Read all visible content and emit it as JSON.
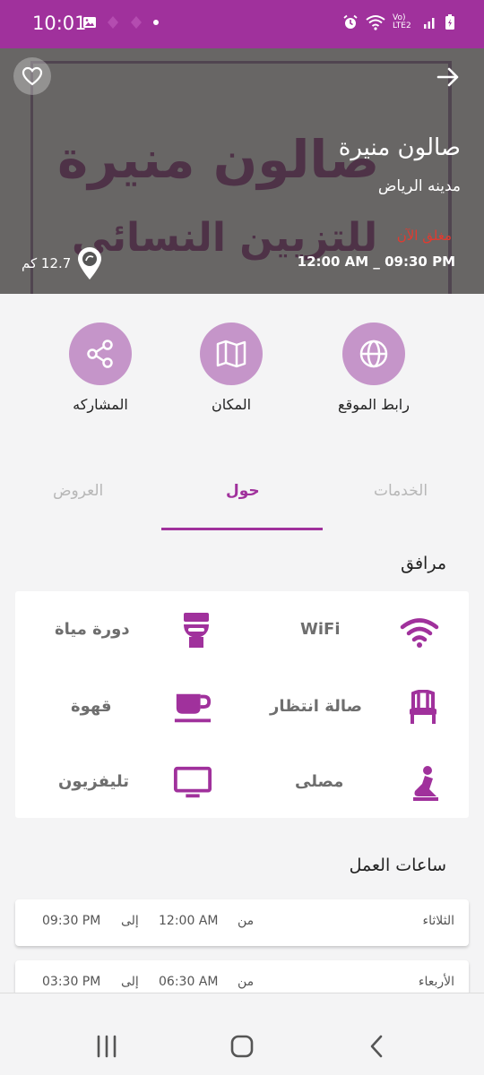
{
  "status_bar": {
    "time": "10:01",
    "network": "Vo) LTE2"
  },
  "hero": {
    "sign_line1": "صالون منيرة",
    "sign_line2": "للتزيين النسائي",
    "name": "صالون منيرة",
    "city": "مدينه الرياض",
    "status": "مغلق الآن",
    "hours": "12:00 AM _ 09:30 PM",
    "distance": "12.7 كم"
  },
  "actions": [
    {
      "label": "رابط الموقع",
      "icon": "globe-icon"
    },
    {
      "label": "المكان",
      "icon": "map-icon"
    },
    {
      "label": "المشاركه",
      "icon": "share-icon"
    }
  ],
  "tabs": {
    "services": "الخدمات",
    "about": "حول",
    "offers": "العروض"
  },
  "facilities_title": "مرافق",
  "facilities": [
    {
      "label": "WiFi",
      "icon": "wifi-icon"
    },
    {
      "label": "دورة مياة",
      "icon": "toilet-icon"
    },
    {
      "label": "صالة انتظار",
      "icon": "chair-icon"
    },
    {
      "label": "قهوة",
      "icon": "coffee-icon"
    },
    {
      "label": "مصلى",
      "icon": "prayer-icon"
    },
    {
      "label": "تليفزيون",
      "icon": "tv-icon"
    }
  ],
  "hours_title": "ساعات العمل",
  "working_hours": [
    {
      "day": "الثلاثاء",
      "from_label": "من",
      "start": "12:00 AM",
      "to_label": "إلى",
      "end": "09:30 PM"
    },
    {
      "day": "الأربعاء",
      "from_label": "من",
      "start": "06:30 AM",
      "to_label": "إلى",
      "end": "03:30 PM"
    }
  ],
  "colors": {
    "accent": "#a0319c",
    "action_circle": "#c595c9",
    "closed_red": "#e33a2f"
  }
}
